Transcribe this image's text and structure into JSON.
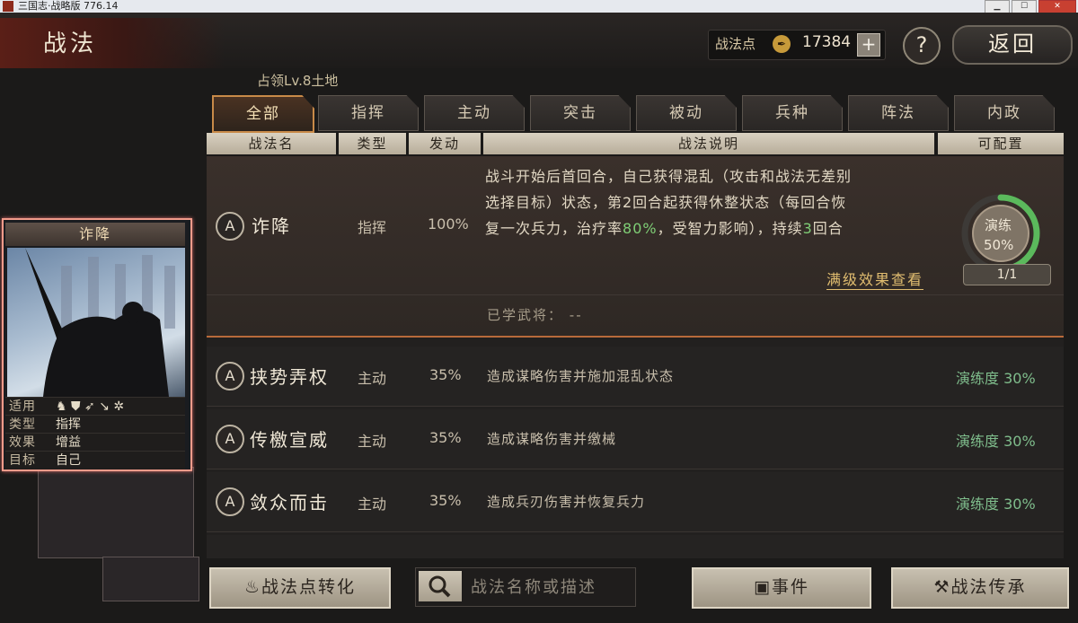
{
  "window": {
    "title": "三国志·战略版 776.14"
  },
  "header": {
    "title": "战法",
    "points_label": "战法点",
    "points_value": "17384",
    "add_label": "+",
    "help_label": "?",
    "back_label": "返回"
  },
  "territory": "占领Lv.8土地",
  "tabs": [
    {
      "label": "全部",
      "active": true
    },
    {
      "label": "指挥"
    },
    {
      "label": "主动"
    },
    {
      "label": "突击"
    },
    {
      "label": "被动"
    },
    {
      "label": "兵种"
    },
    {
      "label": "阵法"
    },
    {
      "label": "内政"
    }
  ],
  "columns": {
    "name": "战法名",
    "type": "类型",
    "rate": "发动",
    "desc": "战法说明",
    "config": "可配置"
  },
  "expanded": {
    "grade": "A",
    "name": "诈降",
    "type": "指挥",
    "rate": "100%",
    "desc_line1": "战斗开始后首回合，自己获得混乱（攻击和战法无差别",
    "desc_line2": "选择目标）状态，第2回合起获得休整状态（每回合恢",
    "desc_line3a": "复一次兵力，治疗率",
    "desc_green1": "80%",
    "desc_line3b": "，受智力影响），持续",
    "desc_green2": "3",
    "desc_line3c": "回合",
    "full_effect": "满级效果查看",
    "learned_label": "已学武将：",
    "learned_value": "--",
    "practice_label": "演练",
    "practice_pct": "50%",
    "practice_fill": 0.5,
    "counter": "1/1"
  },
  "rows": [
    {
      "grade": "A",
      "name": "挟势弄权",
      "type": "主动",
      "rate": "35%",
      "desc": "造成谋略伤害并施加混乱状态",
      "practice": "演练度 30%"
    },
    {
      "grade": "A",
      "name": "传檄宣威",
      "type": "主动",
      "rate": "35%",
      "desc": "造成谋略伤害并缴械",
      "practice": "演练度 30%"
    },
    {
      "grade": "A",
      "name": "敛众而击",
      "type": "主动",
      "rate": "35%",
      "desc": "造成兵刃伤害并恢复兵力",
      "practice": "演练度 30%"
    }
  ],
  "card": {
    "title": "诈降",
    "rows": [
      {
        "key": "适用",
        "value": ""
      },
      {
        "key": "类型",
        "value": "指挥"
      },
      {
        "key": "效果",
        "value": "增益"
      },
      {
        "key": "目标",
        "value": "自己"
      }
    ]
  },
  "bottom": {
    "convert_label": "战法点转化",
    "search_placeholder": "战法名称或描述",
    "event_label": "事件",
    "inherit_label": "战法传承"
  },
  "colors": {
    "accent": "#c88a48",
    "green": "#7fcf76",
    "practice": "#7fbd8c"
  }
}
